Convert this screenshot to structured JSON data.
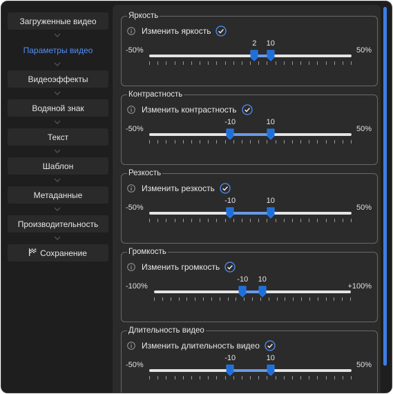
{
  "sidebar": {
    "steps": [
      {
        "label": "Загруженные видео"
      },
      {
        "label": "Параметры видео",
        "active": true
      },
      {
        "label": "Видеоэффекты"
      },
      {
        "label": "Водяной знак"
      },
      {
        "label": "Текст"
      },
      {
        "label": "Шаблон"
      },
      {
        "label": "Метаданные"
      },
      {
        "label": "Производительность"
      },
      {
        "label": "Сохранение",
        "icon": "checkered-flag-icon"
      }
    ]
  },
  "groups": [
    {
      "title": "Яркость",
      "label": "Изменить яркость",
      "checked": true,
      "min_label": "-50%",
      "max_label": "50%",
      "min": -50,
      "max": 50,
      "low": 2,
      "high": 10,
      "low_label": "2",
      "high_label": "10"
    },
    {
      "title": "Контрастность",
      "label": "Изменить контрастность",
      "checked": true,
      "min_label": "-50%",
      "max_label": "50%",
      "min": -50,
      "max": 50,
      "low": -10,
      "high": 10,
      "low_label": "-10",
      "high_label": "10"
    },
    {
      "title": "Резкость",
      "label": "Изменить резкость",
      "checked": true,
      "min_label": "-50%",
      "max_label": "50%",
      "min": -50,
      "max": 50,
      "low": -10,
      "high": 10,
      "low_label": "-10",
      "high_label": "10"
    },
    {
      "title": "Громкость",
      "label": "Изменить громкость",
      "checked": true,
      "min_label": "-100%",
      "max_label": "+100%",
      "min": -100,
      "max": 100,
      "low": -10,
      "high": 10,
      "low_label": "-10",
      "high_label": "10"
    },
    {
      "title": "Длительность видео",
      "label": "Изменить длительность видео",
      "checked": true,
      "min_label": "-50%",
      "max_label": "50%",
      "min": -50,
      "max": 50,
      "low": -10,
      "high": 10,
      "low_label": "-10",
      "high_label": "10"
    }
  ],
  "colors": {
    "accent": "#4f8ff7",
    "thumb": "#1e6fd9",
    "range": "#6b9be6"
  }
}
